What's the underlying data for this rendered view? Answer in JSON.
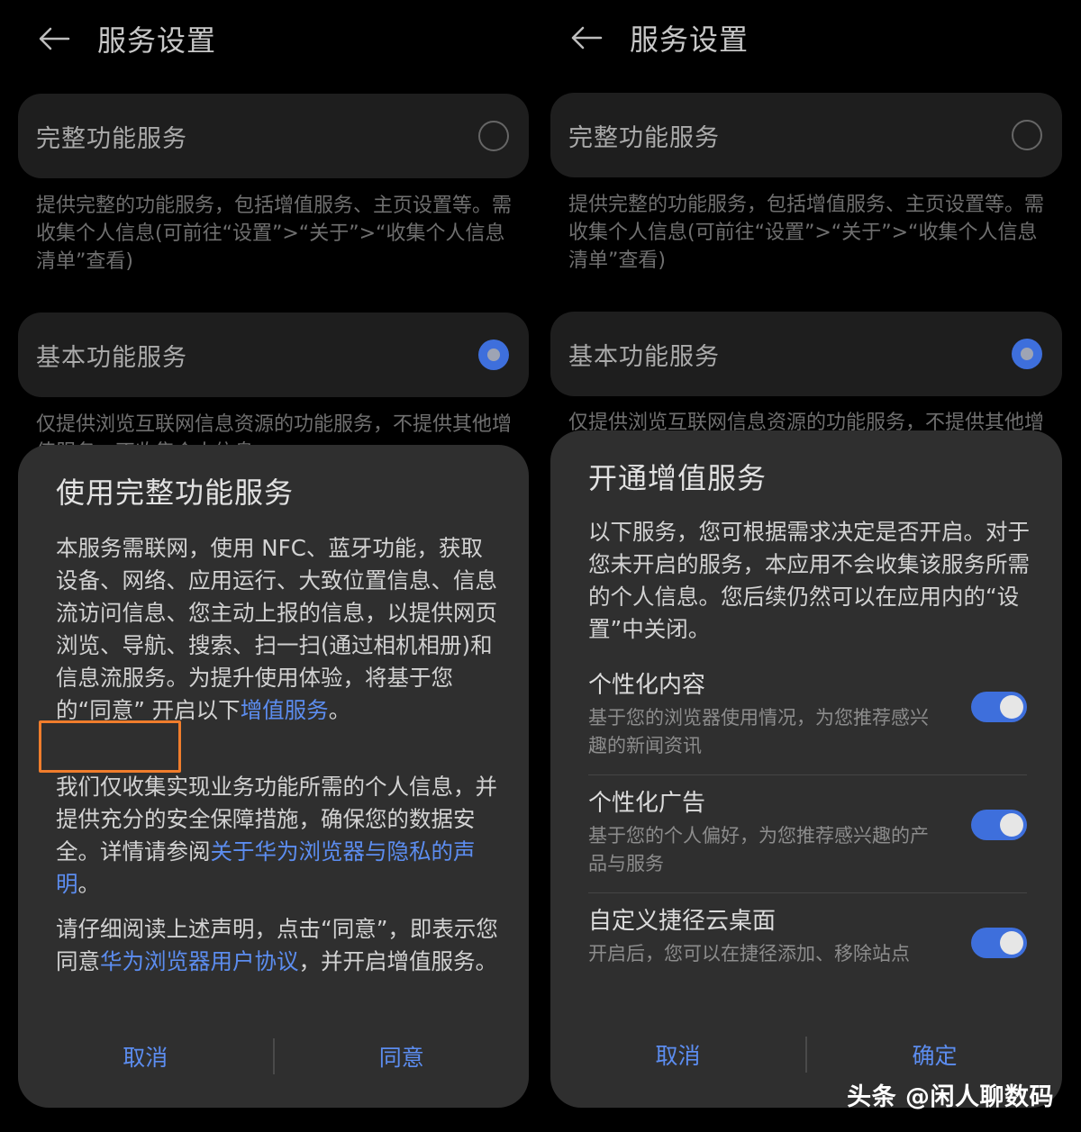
{
  "left": {
    "header": {
      "title": "服务设置"
    },
    "full_service": {
      "label": "完整功能服务",
      "desc": "提供完整的功能服务，包括增值服务、主页设置等。需收集个人信息(可前往“设置”>“关于”>“收集个人信息清单”查看)"
    },
    "basic_service": {
      "label": "基本功能服务",
      "desc": "仅提供浏览互联网信息资源的功能服务，不提供其他增值服务，不收集个人信息"
    },
    "dialog": {
      "title": "使用完整功能服务",
      "p1": "本服务需联网，使用 NFC、蓝牙功能，获取设备、网络、应用运行、大致位置信息、信息流访问信息、您主动上报的信息，以提供网页浏览、导航、搜索、扫一扫(通过相机相册)和信息流服务。为提升使用体验，将基于您的“同意” 开启以下",
      "p1_link": "增值服务",
      "p1_end": "。",
      "p2": "我们仅收集实现业务功能所需的个人信息，并提供充分的安全保障措施，确保您的数据安全。详情请参阅",
      "p2_link": "关于华为浏览器与隐私的声明",
      "p2_end": "。",
      "p3": "请仔细阅读上述声明，点击“同意”，即表示您同意",
      "p3_link": "华为浏览器用户协议",
      "p3_end": "，并开启增值服务。",
      "cancel": "取消",
      "agree": "同意"
    }
  },
  "right": {
    "header": {
      "title": "服务设置"
    },
    "full_service": {
      "label": "完整功能服务",
      "desc": "提供完整的功能服务，包括增值服务、主页设置等。需收集个人信息(可前往“设置”>“关于”>“收集个人信息清单”查看)"
    },
    "basic_service": {
      "label": "基本功能服务",
      "desc": "仅提供浏览互联网信息资源的功能服务，不提供其他增值服务"
    },
    "dialog": {
      "title": "开通增值服务",
      "intro": "以下服务，您可根据需求决定是否开启。对于您未开启的服务，本应用不会收集该服务所需的个人信息。您后续仍然可以在应用内的“设置”中关闭。",
      "options": [
        {
          "title": "个性化内容",
          "desc": "基于您的浏览器使用情况，为您推荐感兴趣的新闻资讯",
          "enabled": true
        },
        {
          "title": "个性化广告",
          "desc": "基于您的个人偏好，为您推荐感兴趣的产品与服务",
          "enabled": true
        },
        {
          "title": "自定义捷径云桌面",
          "desc": "开启后，您可以在捷径添加、移除站点",
          "enabled": true
        }
      ],
      "cancel": "取消",
      "confirm": "确定"
    }
  },
  "watermark": "头条 @闲人聊数码",
  "colors": {
    "accent": "#5c8df0",
    "toggle_on": "#3e6fdc",
    "highlight_box": "#f07d2c"
  }
}
